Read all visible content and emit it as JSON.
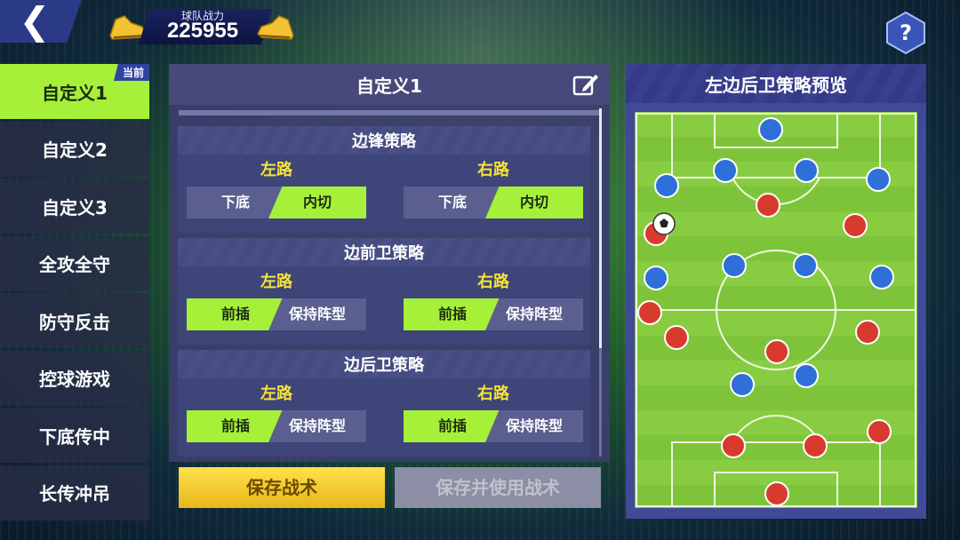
{
  "header": {
    "back_icon": "back-chevron-icon",
    "team_power_label": "球队战力",
    "team_power_value": "225955",
    "boot_icon": "golden-boot-icon",
    "help_symbol": "?"
  },
  "sidebar": {
    "current_badge": "当前",
    "items": [
      {
        "label": "自定义1",
        "active": true
      },
      {
        "label": "自定义2",
        "active": false
      },
      {
        "label": "自定义3",
        "active": false
      },
      {
        "label": "全攻全守",
        "active": false
      },
      {
        "label": "防守反击",
        "active": false
      },
      {
        "label": "控球游戏",
        "active": false
      },
      {
        "label": "下底传中",
        "active": false
      },
      {
        "label": "长传冲吊",
        "active": false
      }
    ]
  },
  "tactics_panel": {
    "title": "自定义1",
    "edit_icon": "edit-pencil-icon",
    "sections": [
      {
        "title": "边锋策略",
        "left": {
          "label": "左路",
          "options": [
            "下底",
            "内切"
          ],
          "selected": "内切"
        },
        "right": {
          "label": "右路",
          "options": [
            "下底",
            "内切"
          ],
          "selected": "内切"
        }
      },
      {
        "title": "边前卫策略",
        "left": {
          "label": "左路",
          "options": [
            "前插",
            "保持阵型"
          ],
          "selected": "前插"
        },
        "right": {
          "label": "右路",
          "options": [
            "前插",
            "保持阵型"
          ],
          "selected": "前插"
        }
      },
      {
        "title": "边后卫策略",
        "left": {
          "label": "左路",
          "options": [
            "前插",
            "保持阵型"
          ],
          "selected": "前插"
        },
        "right": {
          "label": "右路",
          "options": [
            "前插",
            "保持阵型"
          ],
          "selected": "前插"
        }
      }
    ]
  },
  "buttons": {
    "save": "保存战术",
    "save_and_use": "保存并使用战术"
  },
  "preview": {
    "title": "左边后卫策略预览",
    "colors": {
      "home": "#d83a2e",
      "away": "#2f6fd8",
      "pitch": "#7ec43a"
    },
    "ball_icon": "soccer-ball-icon"
  }
}
